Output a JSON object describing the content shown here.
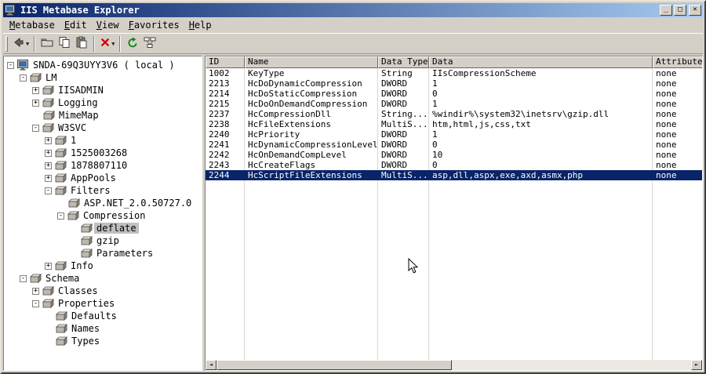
{
  "window": {
    "title": "IIS Metabase Explorer",
    "controls": {
      "minimize": "_",
      "maximize": "□",
      "close": "✕"
    }
  },
  "colors": {
    "titlebar_left": "#0a246a",
    "titlebar_right": "#a6caf0",
    "selection_blue": "#0a246a",
    "chrome_gray": "#d4d0c8"
  },
  "menu": {
    "items": [
      {
        "label": "Metabase"
      },
      {
        "label": "Edit"
      },
      {
        "label": "View"
      },
      {
        "label": "Favorites"
      },
      {
        "label": "Help"
      }
    ]
  },
  "toolbar": {
    "items": [
      {
        "type": "button",
        "name": "back-button",
        "icon": "back-icon",
        "dropdown": true
      },
      {
        "type": "separator"
      },
      {
        "type": "button",
        "name": "new-key-button",
        "icon": "new-key-icon",
        "dropdown": false
      },
      {
        "type": "button",
        "name": "copy-button",
        "icon": "copy-icon",
        "dropdown": false
      },
      {
        "type": "button",
        "name": "paste-button",
        "icon": "paste-icon",
        "dropdown": false
      },
      {
        "type": "separator"
      },
      {
        "type": "button",
        "name": "delete-button",
        "icon": "delete-icon",
        "dropdown": true
      },
      {
        "type": "separator"
      },
      {
        "type": "button",
        "name": "refresh-button",
        "icon": "refresh-icon",
        "dropdown": false
      },
      {
        "type": "button",
        "name": "connect-button",
        "icon": "network-icon",
        "dropdown": false
      }
    ]
  },
  "tree": {
    "items": [
      {
        "label": "SNDA-69Q3UYY3V6 ( local )",
        "level": 0,
        "expand": "-",
        "icon": "computer-icon",
        "selected": false
      },
      {
        "label": "LM",
        "level": 1,
        "expand": "-",
        "icon": "key-icon",
        "selected": false
      },
      {
        "label": "IISADMIN",
        "level": 2,
        "expand": "+",
        "icon": "key-icon",
        "selected": false
      },
      {
        "label": "Logging",
        "level": 2,
        "expand": "+",
        "icon": "key-icon",
        "selected": false
      },
      {
        "label": "MimeMap",
        "level": 2,
        "expand": null,
        "icon": "key-icon",
        "selected": false
      },
      {
        "label": "W3SVC",
        "level": 2,
        "expand": "-",
        "icon": "key-icon",
        "selected": false
      },
      {
        "label": "1",
        "level": 3,
        "expand": "+",
        "icon": "key-icon",
        "selected": false
      },
      {
        "label": "1525003268",
        "level": 3,
        "expand": "+",
        "icon": "key-icon",
        "selected": false
      },
      {
        "label": "1878807110",
        "level": 3,
        "expand": "+",
        "icon": "key-icon",
        "selected": false
      },
      {
        "label": "AppPools",
        "level": 3,
        "expand": "+",
        "icon": "key-icon",
        "selected": false
      },
      {
        "label": "Filters",
        "level": 3,
        "expand": "-",
        "icon": "key-icon",
        "selected": false
      },
      {
        "label": "ASP.NET_2.0.50727.0",
        "level": 4,
        "expand": null,
        "icon": "key-icon",
        "selected": false
      },
      {
        "label": "Compression",
        "level": 4,
        "expand": "-",
        "icon": "key-icon",
        "selected": false
      },
      {
        "label": "deflate",
        "level": 5,
        "expand": null,
        "icon": "key-icon",
        "selected": true
      },
      {
        "label": "gzip",
        "level": 5,
        "expand": null,
        "icon": "key-icon",
        "selected": false
      },
      {
        "label": "Parameters",
        "level": 5,
        "expand": null,
        "icon": "key-icon",
        "selected": false
      },
      {
        "label": "Info",
        "level": 3,
        "expand": "+",
        "icon": "key-icon",
        "selected": false
      },
      {
        "label": "Schema",
        "level": 1,
        "expand": "-",
        "icon": "key-icon",
        "selected": false
      },
      {
        "label": "Classes",
        "level": 2,
        "expand": "+",
        "icon": "key-icon",
        "selected": false
      },
      {
        "label": "Properties",
        "level": 2,
        "expand": "-",
        "icon": "key-icon",
        "selected": false
      },
      {
        "label": "Defaults",
        "level": 3,
        "expand": null,
        "icon": "key-icon",
        "selected": false
      },
      {
        "label": "Names",
        "level": 3,
        "expand": null,
        "icon": "key-icon",
        "selected": false
      },
      {
        "label": "Types",
        "level": 3,
        "expand": null,
        "icon": "key-icon",
        "selected": false
      }
    ]
  },
  "table": {
    "columns": [
      {
        "label": "ID"
      },
      {
        "label": "Name"
      },
      {
        "label": "Data Type"
      },
      {
        "label": "Data"
      },
      {
        "label": "Attributes"
      }
    ],
    "rows": [
      {
        "id": "1002",
        "name": "KeyType",
        "type": "String",
        "data": "IIsCompressionScheme",
        "attributes": "none",
        "selected": false
      },
      {
        "id": "2213",
        "name": "HcDoDynamicCompression",
        "type": "DWORD",
        "data": "1",
        "attributes": "none",
        "selected": false
      },
      {
        "id": "2214",
        "name": "HcDoStaticCompression",
        "type": "DWORD",
        "data": "0",
        "attributes": "none",
        "selected": false
      },
      {
        "id": "2215",
        "name": "HcDoOnDemandCompression",
        "type": "DWORD",
        "data": "1",
        "attributes": "none",
        "selected": false
      },
      {
        "id": "2237",
        "name": "HcCompressionDll",
        "type": "String...",
        "data": "%windir%\\system32\\inetsrv\\gzip.dll",
        "attributes": "none",
        "selected": false
      },
      {
        "id": "2238",
        "name": "HcFileExtensions",
        "type": "MultiS...",
        "data": "htm,html,js,css,txt",
        "attributes": "none",
        "selected": false
      },
      {
        "id": "2240",
        "name": "HcPriority",
        "type": "DWORD",
        "data": "1",
        "attributes": "none",
        "selected": false
      },
      {
        "id": "2241",
        "name": "HcDynamicCompressionLevel",
        "type": "DWORD",
        "data": "0",
        "attributes": "none",
        "selected": false
      },
      {
        "id": "2242",
        "name": "HcOnDemandCompLevel",
        "type": "DWORD",
        "data": "10",
        "attributes": "none",
        "selected": false
      },
      {
        "id": "2243",
        "name": "HcCreateFlags",
        "type": "DWORD",
        "data": "0",
        "attributes": "none",
        "selected": false
      },
      {
        "id": "2244",
        "name": "HcScriptFileExtensions",
        "type": "MultiS...",
        "data": "asp,dll,aspx,exe,axd,asmx,php",
        "attributes": "none",
        "selected": true
      }
    ]
  }
}
